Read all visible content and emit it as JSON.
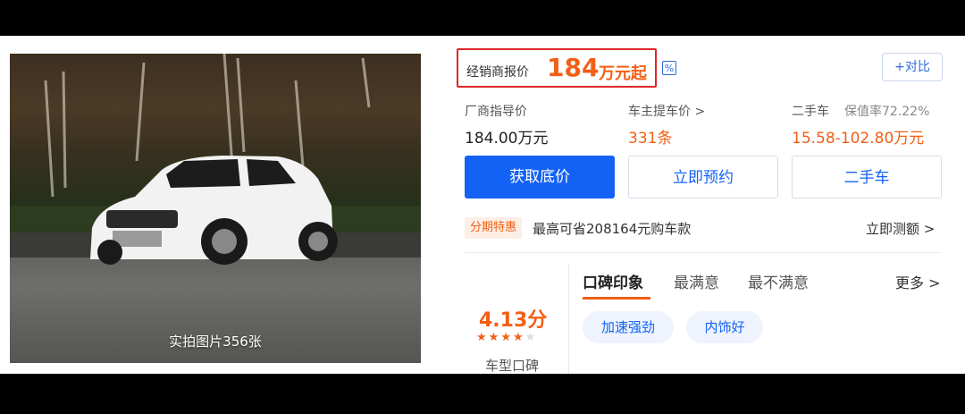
{
  "photo": {
    "caption": "实拍图片356张"
  },
  "price": {
    "label": "经销商报价",
    "value": "184",
    "unit": "万元起",
    "calc_icon": "calculator-icon",
    "compare_label": "+对比"
  },
  "info": [
    {
      "label": "厂商指导价",
      "value": "184.00万元"
    },
    {
      "label": "车主提车价 >",
      "value": "331条"
    },
    {
      "label": "二手车",
      "label_extra": "保值率72.22%",
      "value": "15.58-102.80万元"
    }
  ],
  "buttons": {
    "primary": "获取底价",
    "reserve": "立即预约",
    "used": "二手车"
  },
  "promo": {
    "tag": "分期特惠",
    "text": "最高可省208164元购车款",
    "link": "立即测额 >"
  },
  "review": {
    "score": "4.13分",
    "stars": 4,
    "caption": "车型口碑",
    "tabs": [
      "口碑印象",
      "最满意",
      "最不满意"
    ],
    "more": "更多 >",
    "chips": [
      "加速强劲",
      "内饰好"
    ]
  },
  "colors": {
    "accent": "#f25f15",
    "primary": "#1462f5",
    "highlight_box": "#e0262a"
  }
}
